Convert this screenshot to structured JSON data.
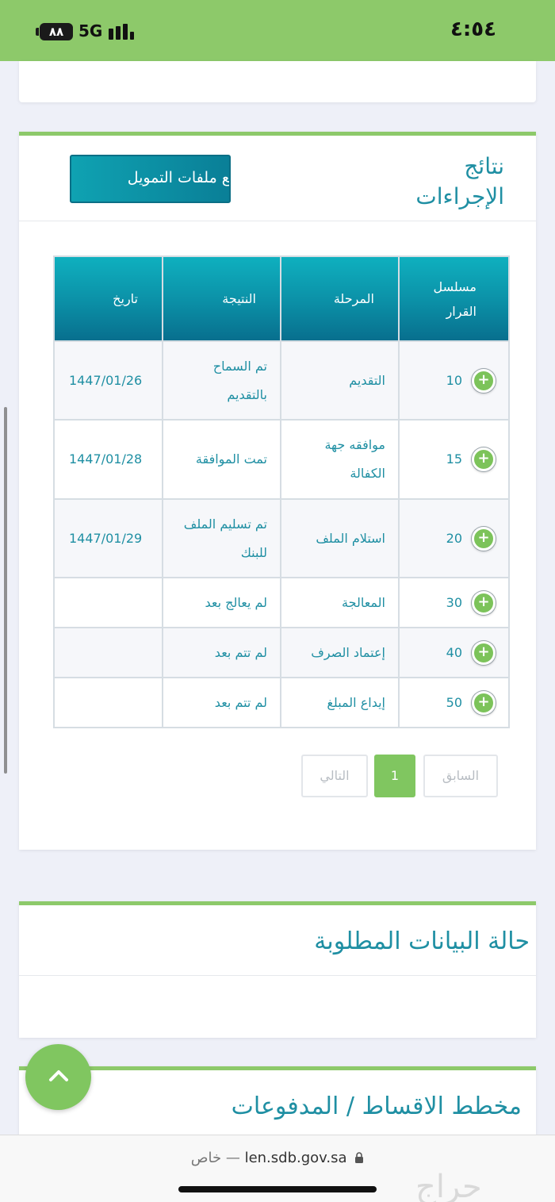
{
  "status_bar": {
    "battery": "٨٨",
    "network": "5G",
    "time": "٤:٥٤"
  },
  "results": {
    "title": "نتائج الإجراءات",
    "upload_button": "فع ملفات التمويل",
    "columns": [
      "مسلسل القرار",
      "المرحلة",
      "النتيجة",
      "تاريخ"
    ],
    "rows": [
      {
        "serial": "10",
        "stage": "التقديم",
        "result": "تم السماح بالتقديم",
        "date": "1447/01/26"
      },
      {
        "serial": "15",
        "stage": "موافقه جهة الكفالة",
        "result": "تمت الموافقة",
        "date": "1447/01/28"
      },
      {
        "serial": "20",
        "stage": "استلام الملف",
        "result": "تم تسليم الملف للبنك",
        "date": "1447/01/29"
      },
      {
        "serial": "30",
        "stage": "المعالجة",
        "result": "لم يعالج بعد",
        "date": ""
      },
      {
        "serial": "40",
        "stage": "إعتماد الصرف",
        "result": "لم تتم بعد",
        "date": ""
      },
      {
        "serial": "50",
        "stage": "إيداع المبلغ",
        "result": "لم تتم بعد",
        "date": ""
      }
    ],
    "pagination": {
      "prev": "السابق",
      "current": "1",
      "next": "التالي"
    }
  },
  "status_section": {
    "title": "حالة البيانات المطلوبة"
  },
  "plan_section": {
    "title": "مخطط الاقساط / المدفوعات"
  },
  "url_bar": {
    "domain": "len.sdb.gov.sa",
    "private_label": "خاص"
  },
  "watermark": "حراج",
  "colors": {
    "accent_green": "#8dc96a",
    "teal": "#1f8fa3",
    "header_teal": "#0b8fa6"
  }
}
